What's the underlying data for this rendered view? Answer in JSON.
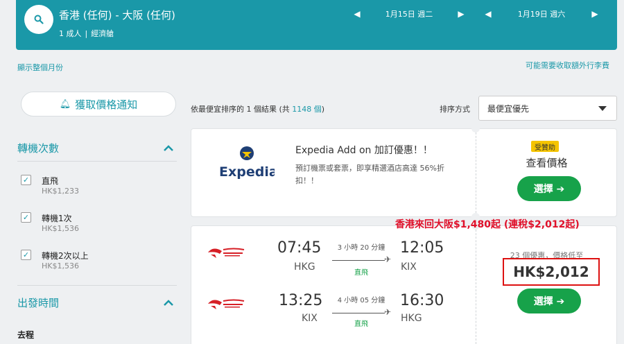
{
  "header": {
    "route": "香港 (任何) - 大阪 (任何)",
    "travellers": "1 成人",
    "cabin": "經濟艙",
    "depart_date": "1月15日 週二",
    "return_date": "1月19日 週六",
    "arrow_left": "◀",
    "arrow_right": "▶",
    "search_icon": "search-icon"
  },
  "links": {
    "show_month": "顯示整個月份",
    "extra_fees": "可能需要收取額外行李費"
  },
  "sidebar": {
    "alert_button": "獲取價格通知",
    "stops_title": "轉機次數",
    "stops": [
      {
        "label": "直飛",
        "price": "HK$1,233",
        "checked": true
      },
      {
        "label": "轉機1次",
        "price": "HK$1,536",
        "checked": true
      },
      {
        "label": "轉機2次以上",
        "price": "HK$1,536",
        "checked": true
      }
    ],
    "departure_title": "出發時間",
    "outbound_label": "去程",
    "check_mark": "✓",
    "chevron": "︿"
  },
  "results": {
    "prefix": "依最便宜排序的 1 個結果 (共 ",
    "total": "1148 個",
    "suffix": ")",
    "sort_label": "排序方式",
    "sort_value": "最便宜優先"
  },
  "ad_card": {
    "logo_text": "Expedia",
    "title": "Expedia Add on 加訂優惠！！",
    "desc": "預訂機票或套票，即享精選酒店高達 56%折扣！！",
    "badge": "受贊助",
    "view_price": "查看價格",
    "select": "選擇 ➔"
  },
  "flight_card": {
    "outbound": {
      "dep_time": "07:45",
      "dep_airport": "HKG",
      "duration": "3 小時 20 分鐘",
      "stops": "直飛",
      "arr_time": "12:05",
      "arr_airport": "KIX"
    },
    "inbound": {
      "dep_time": "13:25",
      "dep_airport": "KIX",
      "duration": "4 小時 05 分鐘",
      "stops": "直飛",
      "arr_time": "16:30",
      "arr_airport": "HKG"
    },
    "plane": "✈",
    "deals": "23 個優惠，價格低至",
    "price": "HK$2,012",
    "select": "選擇 ➔"
  },
  "annotation": "香港來回大阪$1,480起 (連稅$2,012起)",
  "colors": {
    "teal": "#1a98a8",
    "green": "#17a24a",
    "red": "#e0102a",
    "gold": "#f5c400"
  }
}
